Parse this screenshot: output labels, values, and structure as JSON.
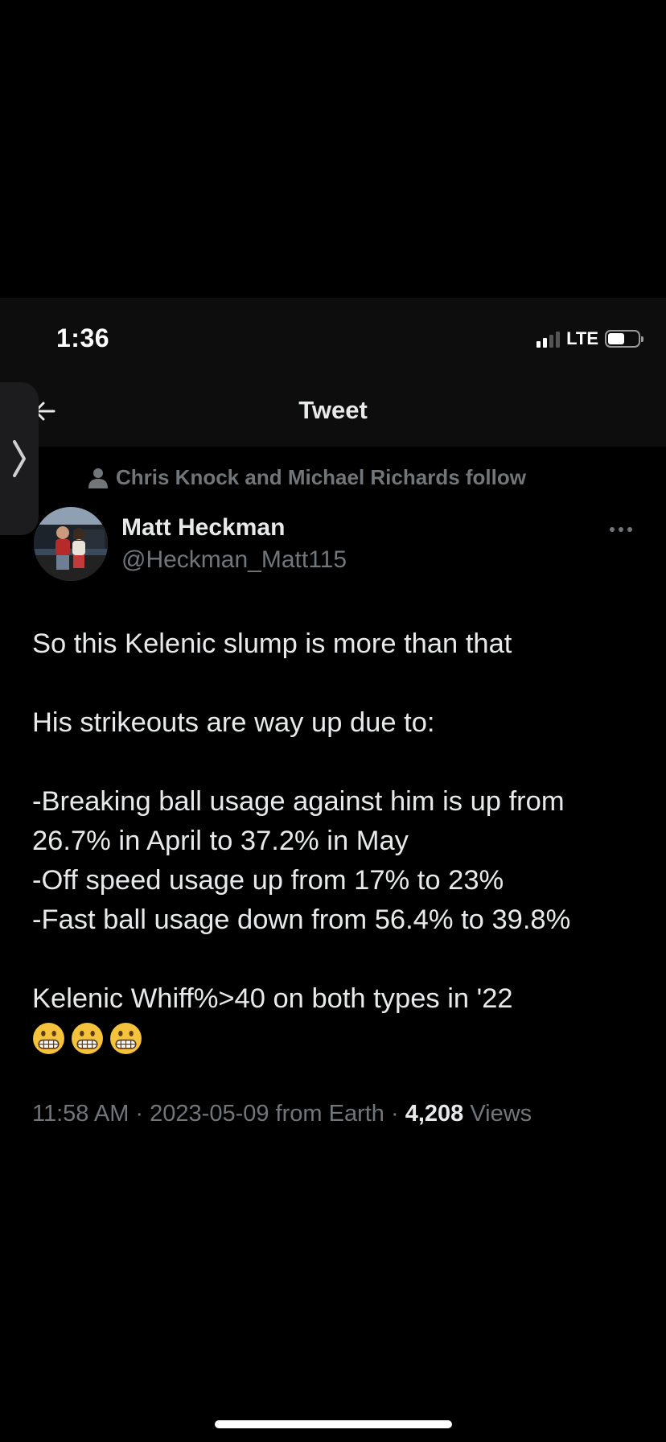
{
  "status_bar": {
    "time": "1:36",
    "network": "LTE",
    "signal_bars_active": 2,
    "signal_bars_total": 4,
    "battery_level": 0.55
  },
  "nav": {
    "title": "Tweet",
    "back_icon": "arrow-left-icon"
  },
  "side_tab": {
    "icon": "chevron-right-icon"
  },
  "tweet": {
    "social_context": "Chris Knock and Michael Richards follow",
    "social_context_icon": "person-icon",
    "author": {
      "name": "Matt Heckman",
      "handle": "@Heckman_Matt115"
    },
    "more_icon": "more-dots-icon",
    "text_lines": [
      "So this Kelenic slump is more than that",
      "",
      "His strikeouts are way up due to:",
      "",
      "-Breaking ball usage against him is up from",
      "26.7% in April to 37.2% in May",
      "-Off speed usage up from 17% to 23%",
      "-Fast ball usage down from 56.4% to 39.8%",
      "",
      "Kelenic Whiff%>40 on both types in '22"
    ],
    "emoji": [
      "grimacing-face-emoji",
      "grimacing-face-emoji",
      "grimacing-face-emoji"
    ],
    "meta": {
      "time_date": "11:58 AM · 2023-05-09 from Earth · ",
      "views_count": "4,208",
      "views_label": " Views"
    }
  },
  "colors": {
    "background": "#000000",
    "header_background": "#0d0d0d",
    "primary_text": "#e7e9ea",
    "secondary_text": "#71767b"
  }
}
